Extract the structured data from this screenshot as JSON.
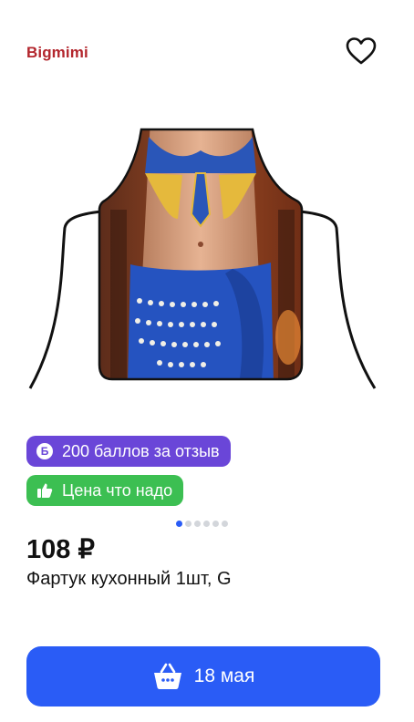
{
  "seller": {
    "name": "Bigmimi"
  },
  "icons": {
    "favorite": "heart-icon",
    "points": "points-b-icon",
    "price": "thumbs-up-icon",
    "cart": "basket-icon"
  },
  "product": {
    "image_description": "apron",
    "price": "108 ₽",
    "title": "Фартук кухонный 1шт, G"
  },
  "badges": {
    "points": {
      "icon_letter": "Б",
      "label": "200 баллов за отзыв",
      "color": "#6a46d8"
    },
    "price_tag": {
      "label": "Цена что надо",
      "color": "#3cbf52"
    }
  },
  "gallery": {
    "total": 6,
    "active_index": 0
  },
  "delivery_button": {
    "label": "18 мая",
    "color": "#2a5cf6"
  },
  "colors": {
    "brand": "#b3262d",
    "accent": "#2a5cf6"
  }
}
